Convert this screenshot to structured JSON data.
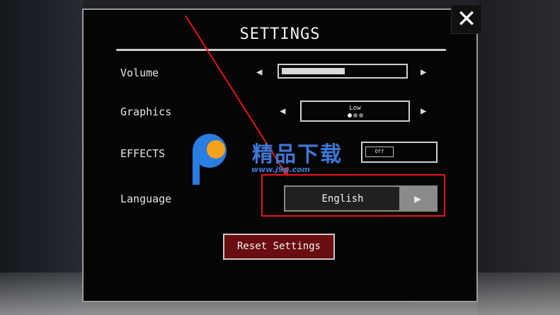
{
  "settings": {
    "title": "SETTINGS",
    "close_symbol": "✕",
    "volume": {
      "label": "Volume",
      "level": 0.52
    },
    "graphics": {
      "label": "Graphics",
      "value": "Low",
      "level_index": 1,
      "levels": 3
    },
    "effects": {
      "label": "EFFECTS",
      "value": "Off"
    },
    "language": {
      "label": "Language",
      "value": "English"
    },
    "reset_label": "Reset Settings"
  },
  "arrows": {
    "left": "◀",
    "right": "▶"
  },
  "watermark": {
    "text": "精品下载",
    "url": "www.j9p.com"
  },
  "colors": {
    "accent_red": "#e3141a",
    "reset_bg": "#6a0d10",
    "watermark_blue": "#3f77d6"
  },
  "icons": [
    "close-icon",
    "arrow-left-icon",
    "arrow-right-icon",
    "watermark-logo-icon"
  ]
}
